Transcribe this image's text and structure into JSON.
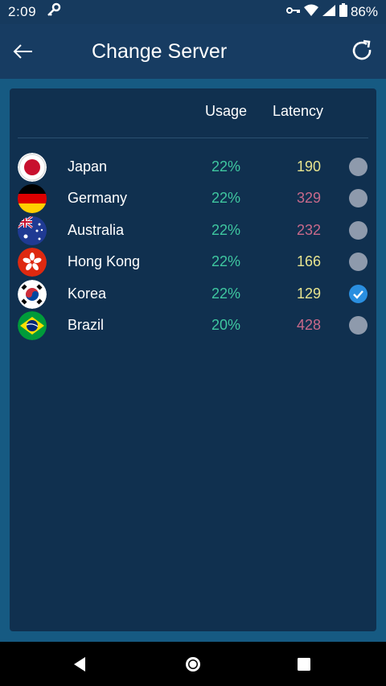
{
  "status_bar": {
    "time": "2:09",
    "battery": "86%"
  },
  "app_bar": {
    "title": "Change Server"
  },
  "table": {
    "headers": {
      "usage": "Usage",
      "latency": "Latency"
    },
    "rows": [
      {
        "country": "Japan",
        "usage": "22%",
        "latency": "190",
        "latency_color": "#e8e48f",
        "flag": "japan-flag-icon",
        "selected": false
      },
      {
        "country": "Germany",
        "usage": "22%",
        "latency": "329",
        "latency_color": "#c8698a",
        "flag": "germany-flag-icon",
        "selected": false
      },
      {
        "country": "Australia",
        "usage": "22%",
        "latency": "232",
        "latency_color": "#c8698a",
        "flag": "australia-flag-icon",
        "selected": false
      },
      {
        "country": "Hong Kong",
        "usage": "22%",
        "latency": "166",
        "latency_color": "#e8e48f",
        "flag": "hong-kong-flag-icon",
        "selected": false
      },
      {
        "country": "Korea",
        "usage": "22%",
        "latency": "129",
        "latency_color": "#e8e48f",
        "flag": "korea-flag-icon",
        "selected": true
      },
      {
        "country": "Brazil",
        "usage": "20%",
        "latency": "428",
        "latency_color": "#c8698a",
        "flag": "brazil-flag-icon",
        "selected": false
      }
    ]
  },
  "colors": {
    "usage": "#3fc7a0",
    "radio_unselected": "#8e9aac",
    "radio_selected": "#2a8fe0",
    "panel": "#10304f"
  }
}
